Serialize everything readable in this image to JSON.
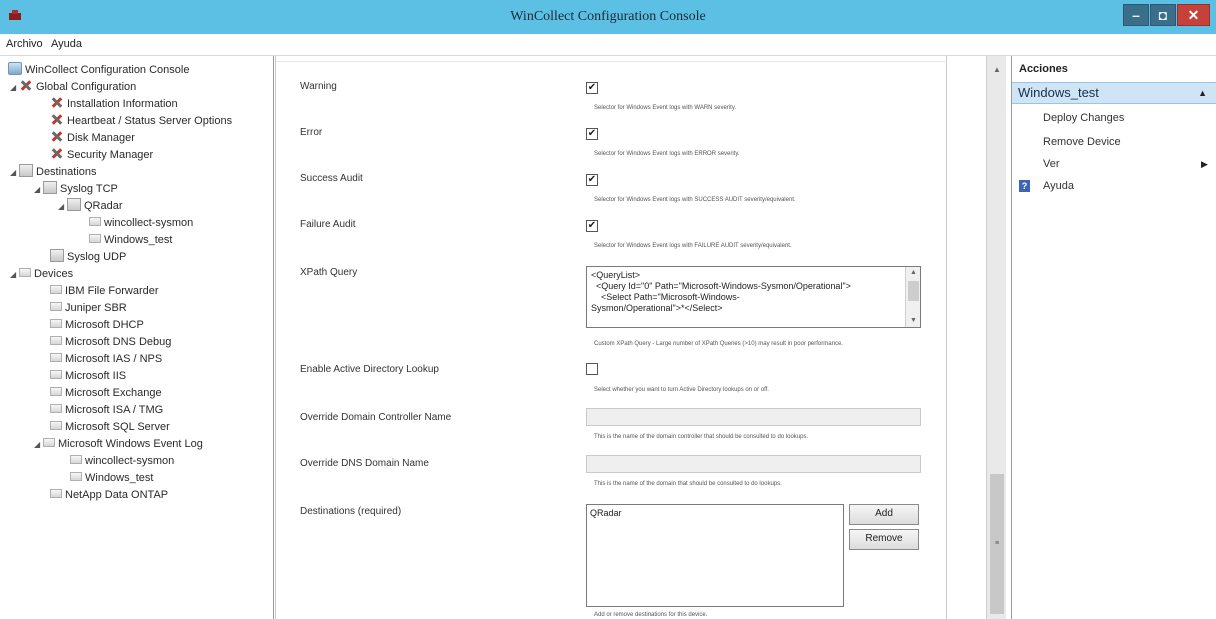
{
  "window": {
    "title": "WinCollect Configuration Console",
    "minimize_icon": "minimize-icon",
    "maximize_icon": "maximize-icon",
    "close_icon": "close-icon",
    "title_bar_color": "#5bc0e3",
    "close_color": "#c7413b"
  },
  "menu": {
    "archivo": "Archivo",
    "ayuda": "Ayuda"
  },
  "tree": {
    "root": "WinCollect Configuration Console",
    "global_configuration": "Global Configuration",
    "installation_information": "Installation Information",
    "heartbeat_status": "Heartbeat / Status Server Options",
    "disk_manager": "Disk Manager",
    "security_manager": "Security Manager",
    "destinations": "Destinations",
    "syslog_tcp": "Syslog TCP",
    "qradar": "QRadar",
    "dest_wincollect_sysmon": "wincollect-sysmon",
    "dest_windows_test": "Windows_test",
    "syslog_udp": "Syslog UDP",
    "devices": "Devices",
    "ibm_file_forwarder": "IBM File Forwarder",
    "juniper_sbr": "Juniper SBR",
    "microsoft_dhcp": "Microsoft DHCP",
    "microsoft_dns_debug": "Microsoft DNS Debug",
    "microsoft_ias_nps": "Microsoft IAS / NPS",
    "microsoft_iis": "Microsoft IIS",
    "microsoft_exchange": "Microsoft Exchange",
    "microsoft_isa_tmg": "Microsoft ISA / TMG",
    "microsoft_sql_server": "Microsoft SQL Server",
    "microsoft_windows_event_log": "Microsoft Windows Event Log",
    "dev_wincollect_sysmon": "wincollect-sysmon",
    "dev_windows_test": "Windows_test",
    "netapp_data_ontap": "NetApp Data ONTAP"
  },
  "form": {
    "warning_label": "Warning",
    "warning_checked": true,
    "warning_desc": "Selector for Windows Event logs with WARN severity.",
    "error_label": "Error",
    "error_checked": true,
    "error_desc": "Selector for Windows Event logs with ERROR severity.",
    "success_audit_label": "Success Audit",
    "success_audit_checked": true,
    "success_audit_desc": "Selector for Windows Event logs with SUCCESS AUDIT severity/equivalent.",
    "failure_audit_label": "Failure Audit",
    "failure_audit_checked": true,
    "failure_audit_desc": "Selector for Windows Event logs with FAILURE AUDIT severity/equivalent.",
    "xpath_label": "XPath Query",
    "xpath_line1": "<QueryList>",
    "xpath_line2": "  <Query Id=\"0\" Path=\"Microsoft-Windows-Sysmon/Operational\">",
    "xpath_line3": "    <Select Path=\"Microsoft-Windows-",
    "xpath_line4": "Sysmon/Operational\">*</Select>",
    "xpath_desc": "Custom XPath Query - Large number of XPath Queries (>10) may result in poor performance.",
    "ad_lookup_label": "Enable Active Directory Lookup",
    "ad_lookup_checked": false,
    "ad_lookup_desc": "Select whether you want to turn Active Directory lookups on or off.",
    "domain_controller_label": "Override Domain Controller Name",
    "domain_controller_value": "",
    "domain_controller_desc": "This is the name of the domain controller that should be consulted to do lookups.",
    "dns_domain_label": "Override DNS Domain Name",
    "dns_domain_value": "",
    "dns_domain_desc": "This is the name of the domain that should be consulted to do lookups.",
    "destinations_label": "Destinations (required)",
    "destinations_items": [
      "QRadar"
    ],
    "add_button": "Add",
    "remove_button": "Remove",
    "destinations_desc": "Add or remove destinations for this device."
  },
  "actions": {
    "header": "Acciones",
    "selected": "Windows_test",
    "deploy_changes": "Deploy Changes",
    "remove_device": "Remove Device",
    "ver": "Ver",
    "ayuda": "Ayuda"
  }
}
